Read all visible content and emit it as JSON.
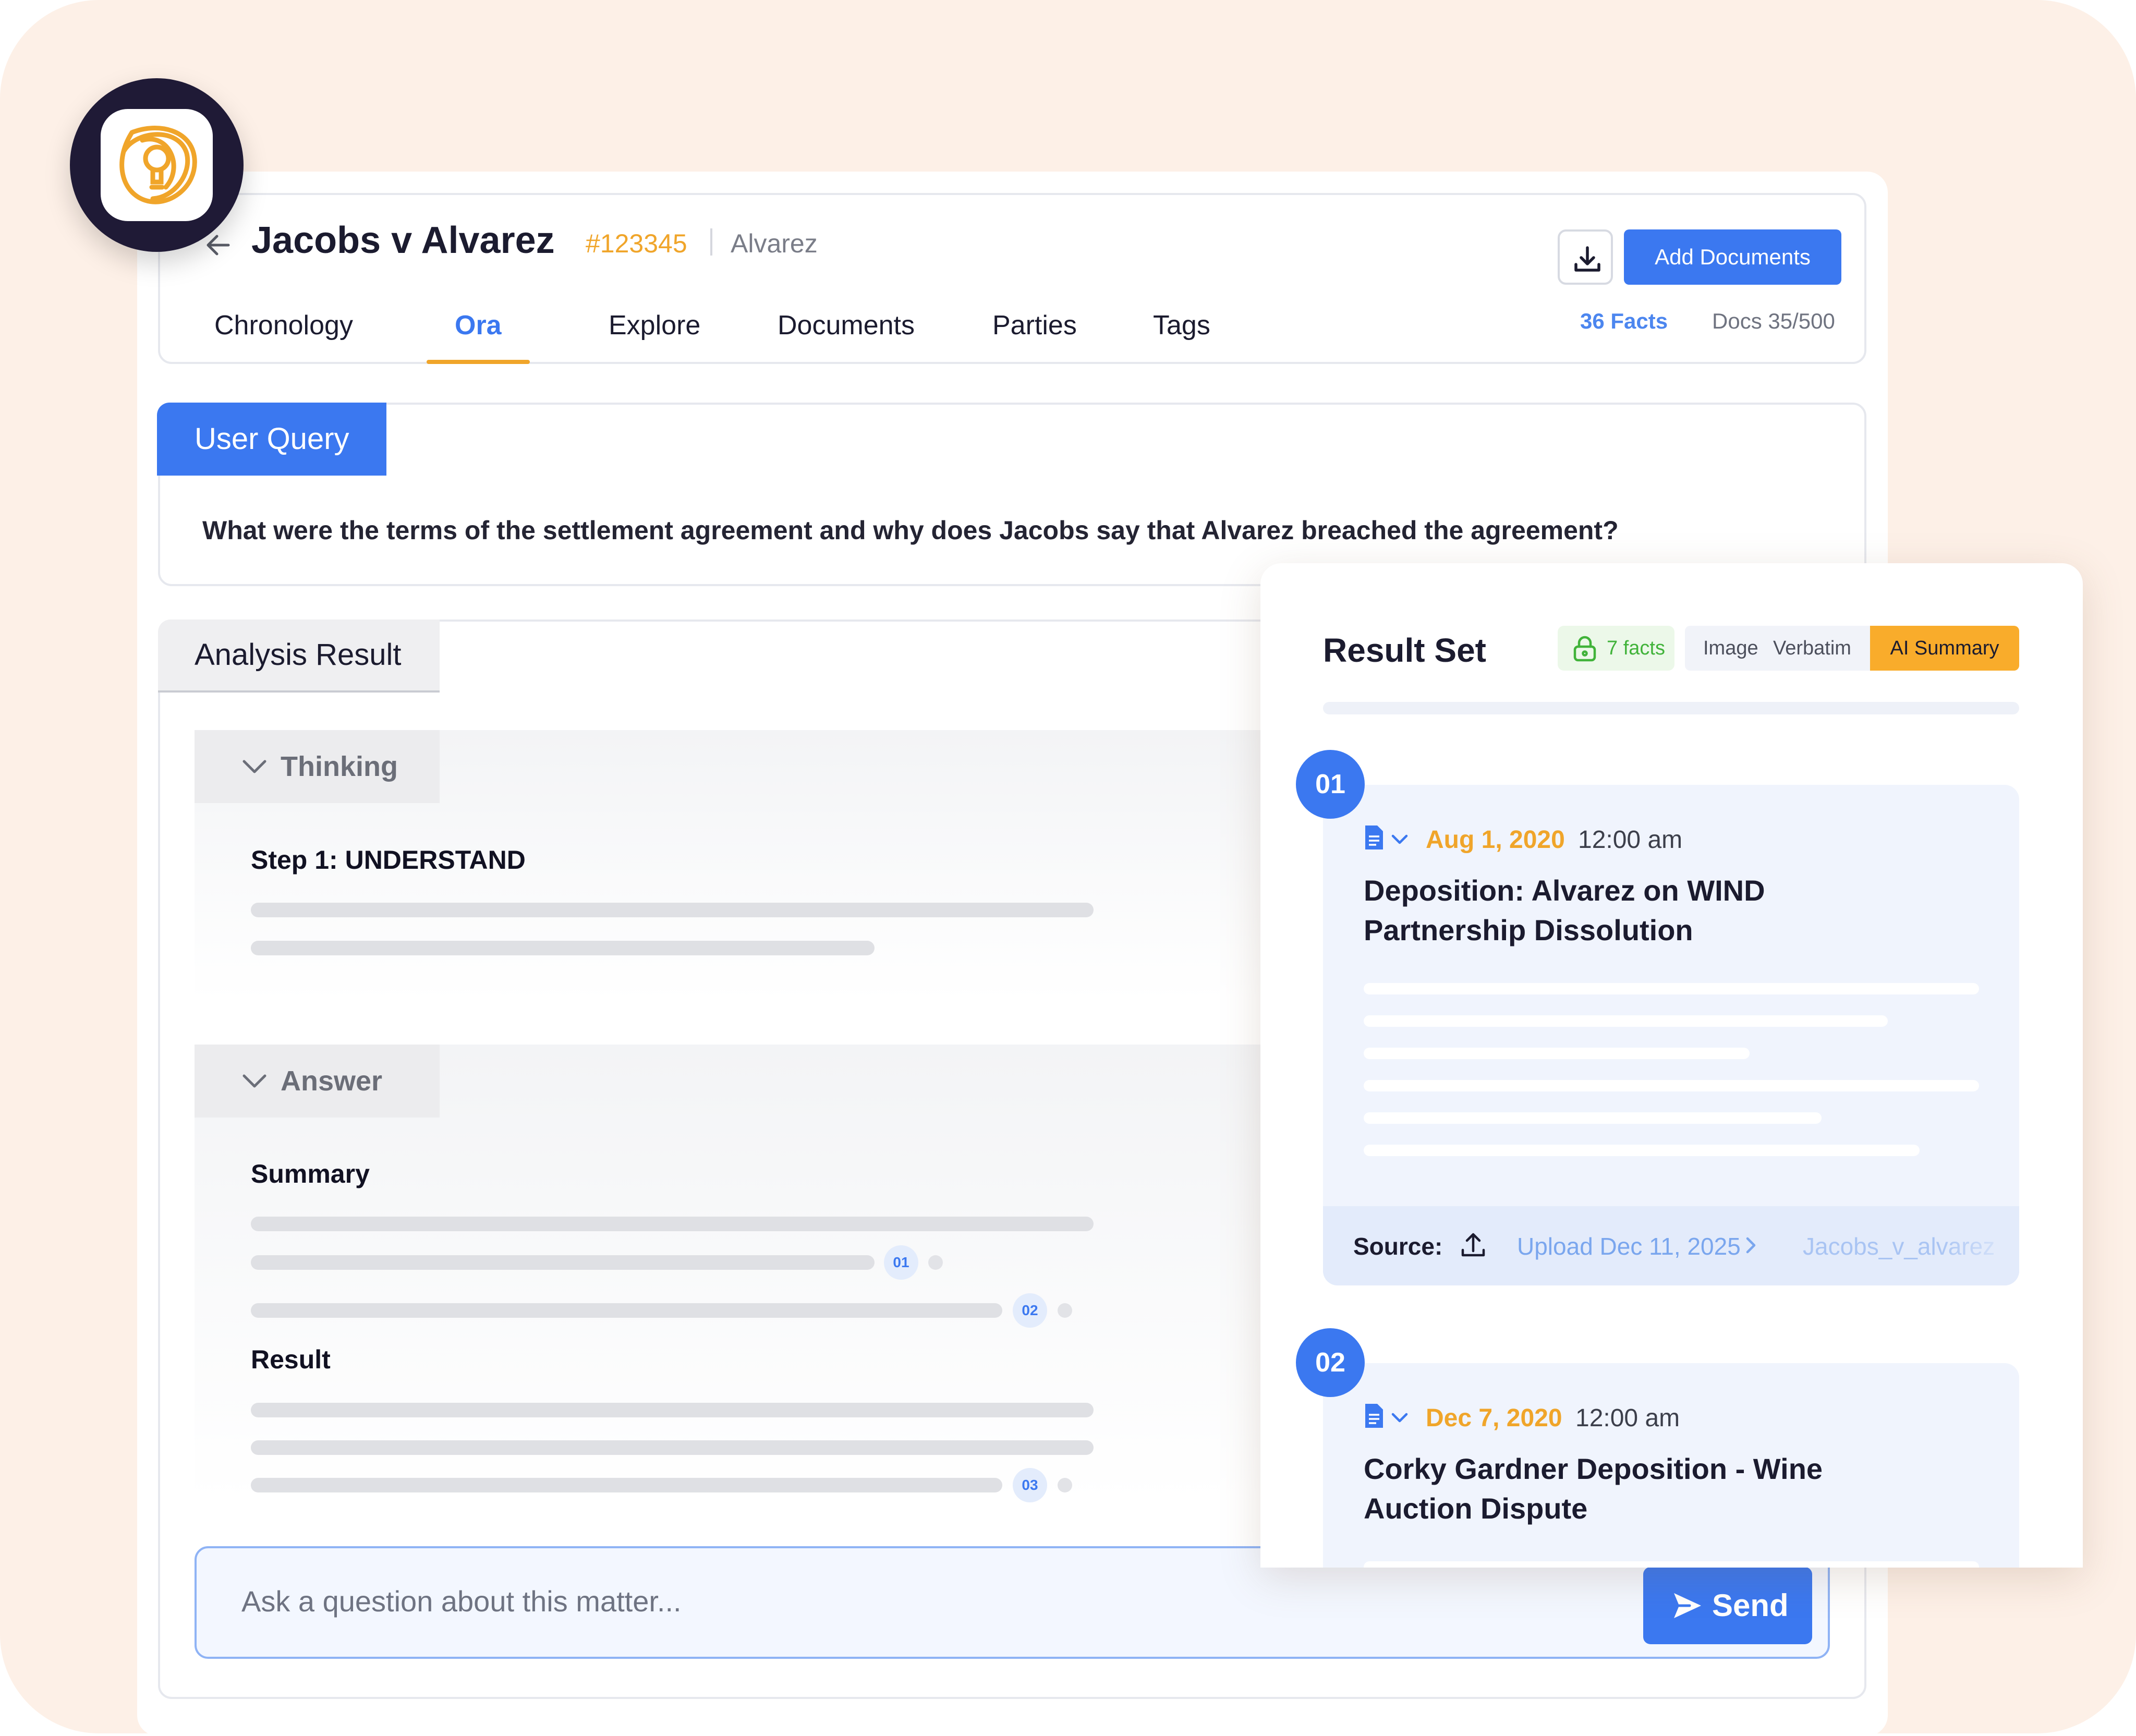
{
  "header": {
    "case_title": "Jacobs v Alvarez",
    "case_number": "#123345",
    "party": "Alvarez",
    "add_documents_label": "Add Documents",
    "facts_count": "36 Facts",
    "docs_count": "Docs 35/500"
  },
  "tabs": [
    {
      "label": "Chronology"
    },
    {
      "label": "Ora"
    },
    {
      "label": "Explore"
    },
    {
      "label": "Documents"
    },
    {
      "label": "Parties"
    },
    {
      "label": "Tags"
    }
  ],
  "active_tab": "Ora",
  "query": {
    "label": "User Query",
    "text": "What were the terms of the settlement agreement and why does Jacobs say that Alvarez breached the agreement?"
  },
  "analysis": {
    "tab_label": "Analysis Result",
    "thinking_label": "Thinking",
    "step_heading": "Step 1: UNDERSTAND",
    "answer_label": "Answer",
    "summary_heading": "Summary",
    "result_heading": "Result",
    "citations": [
      "01",
      "02",
      "03"
    ]
  },
  "ask": {
    "placeholder": "Ask a question about this matter...",
    "send_label": "Send"
  },
  "result_set": {
    "title": "Result Set",
    "facts_chip": "7 facts",
    "toggle_image": "Image",
    "toggle_verbatim": "Verbatim",
    "toggle_ai_summary": "AI Summary",
    "active_toggle": "AI Summary",
    "facts": [
      {
        "number": "01",
        "date": "Aug 1, 2020",
        "time": "12:00 am",
        "title": "Deposition: Alvarez on WIND Partnership Dissolution",
        "source_label": "Source:",
        "source_upload": "Upload Dec 11, 2025",
        "source_file": "Jacobs_v_alvarez"
      },
      {
        "number": "02",
        "date": "Dec 7, 2020",
        "time": "12:00 am",
        "title": "Corky Gardner Deposition - Wine Auction Dispute"
      }
    ]
  },
  "colors": {
    "accent": "#3b78f0",
    "highlight": "#f0a52a",
    "ai_summary": "#f9ac2b",
    "facts_green": "#41b33a",
    "background": "#fdf0e7",
    "logo_ring": "#1f1a36"
  },
  "icons": [
    "app-logo-icon",
    "back-arrow-icon",
    "download-icon",
    "chevron-down-icon",
    "lock-icon",
    "document-icon",
    "upload-icon",
    "chevron-right-icon",
    "send-icon"
  ]
}
